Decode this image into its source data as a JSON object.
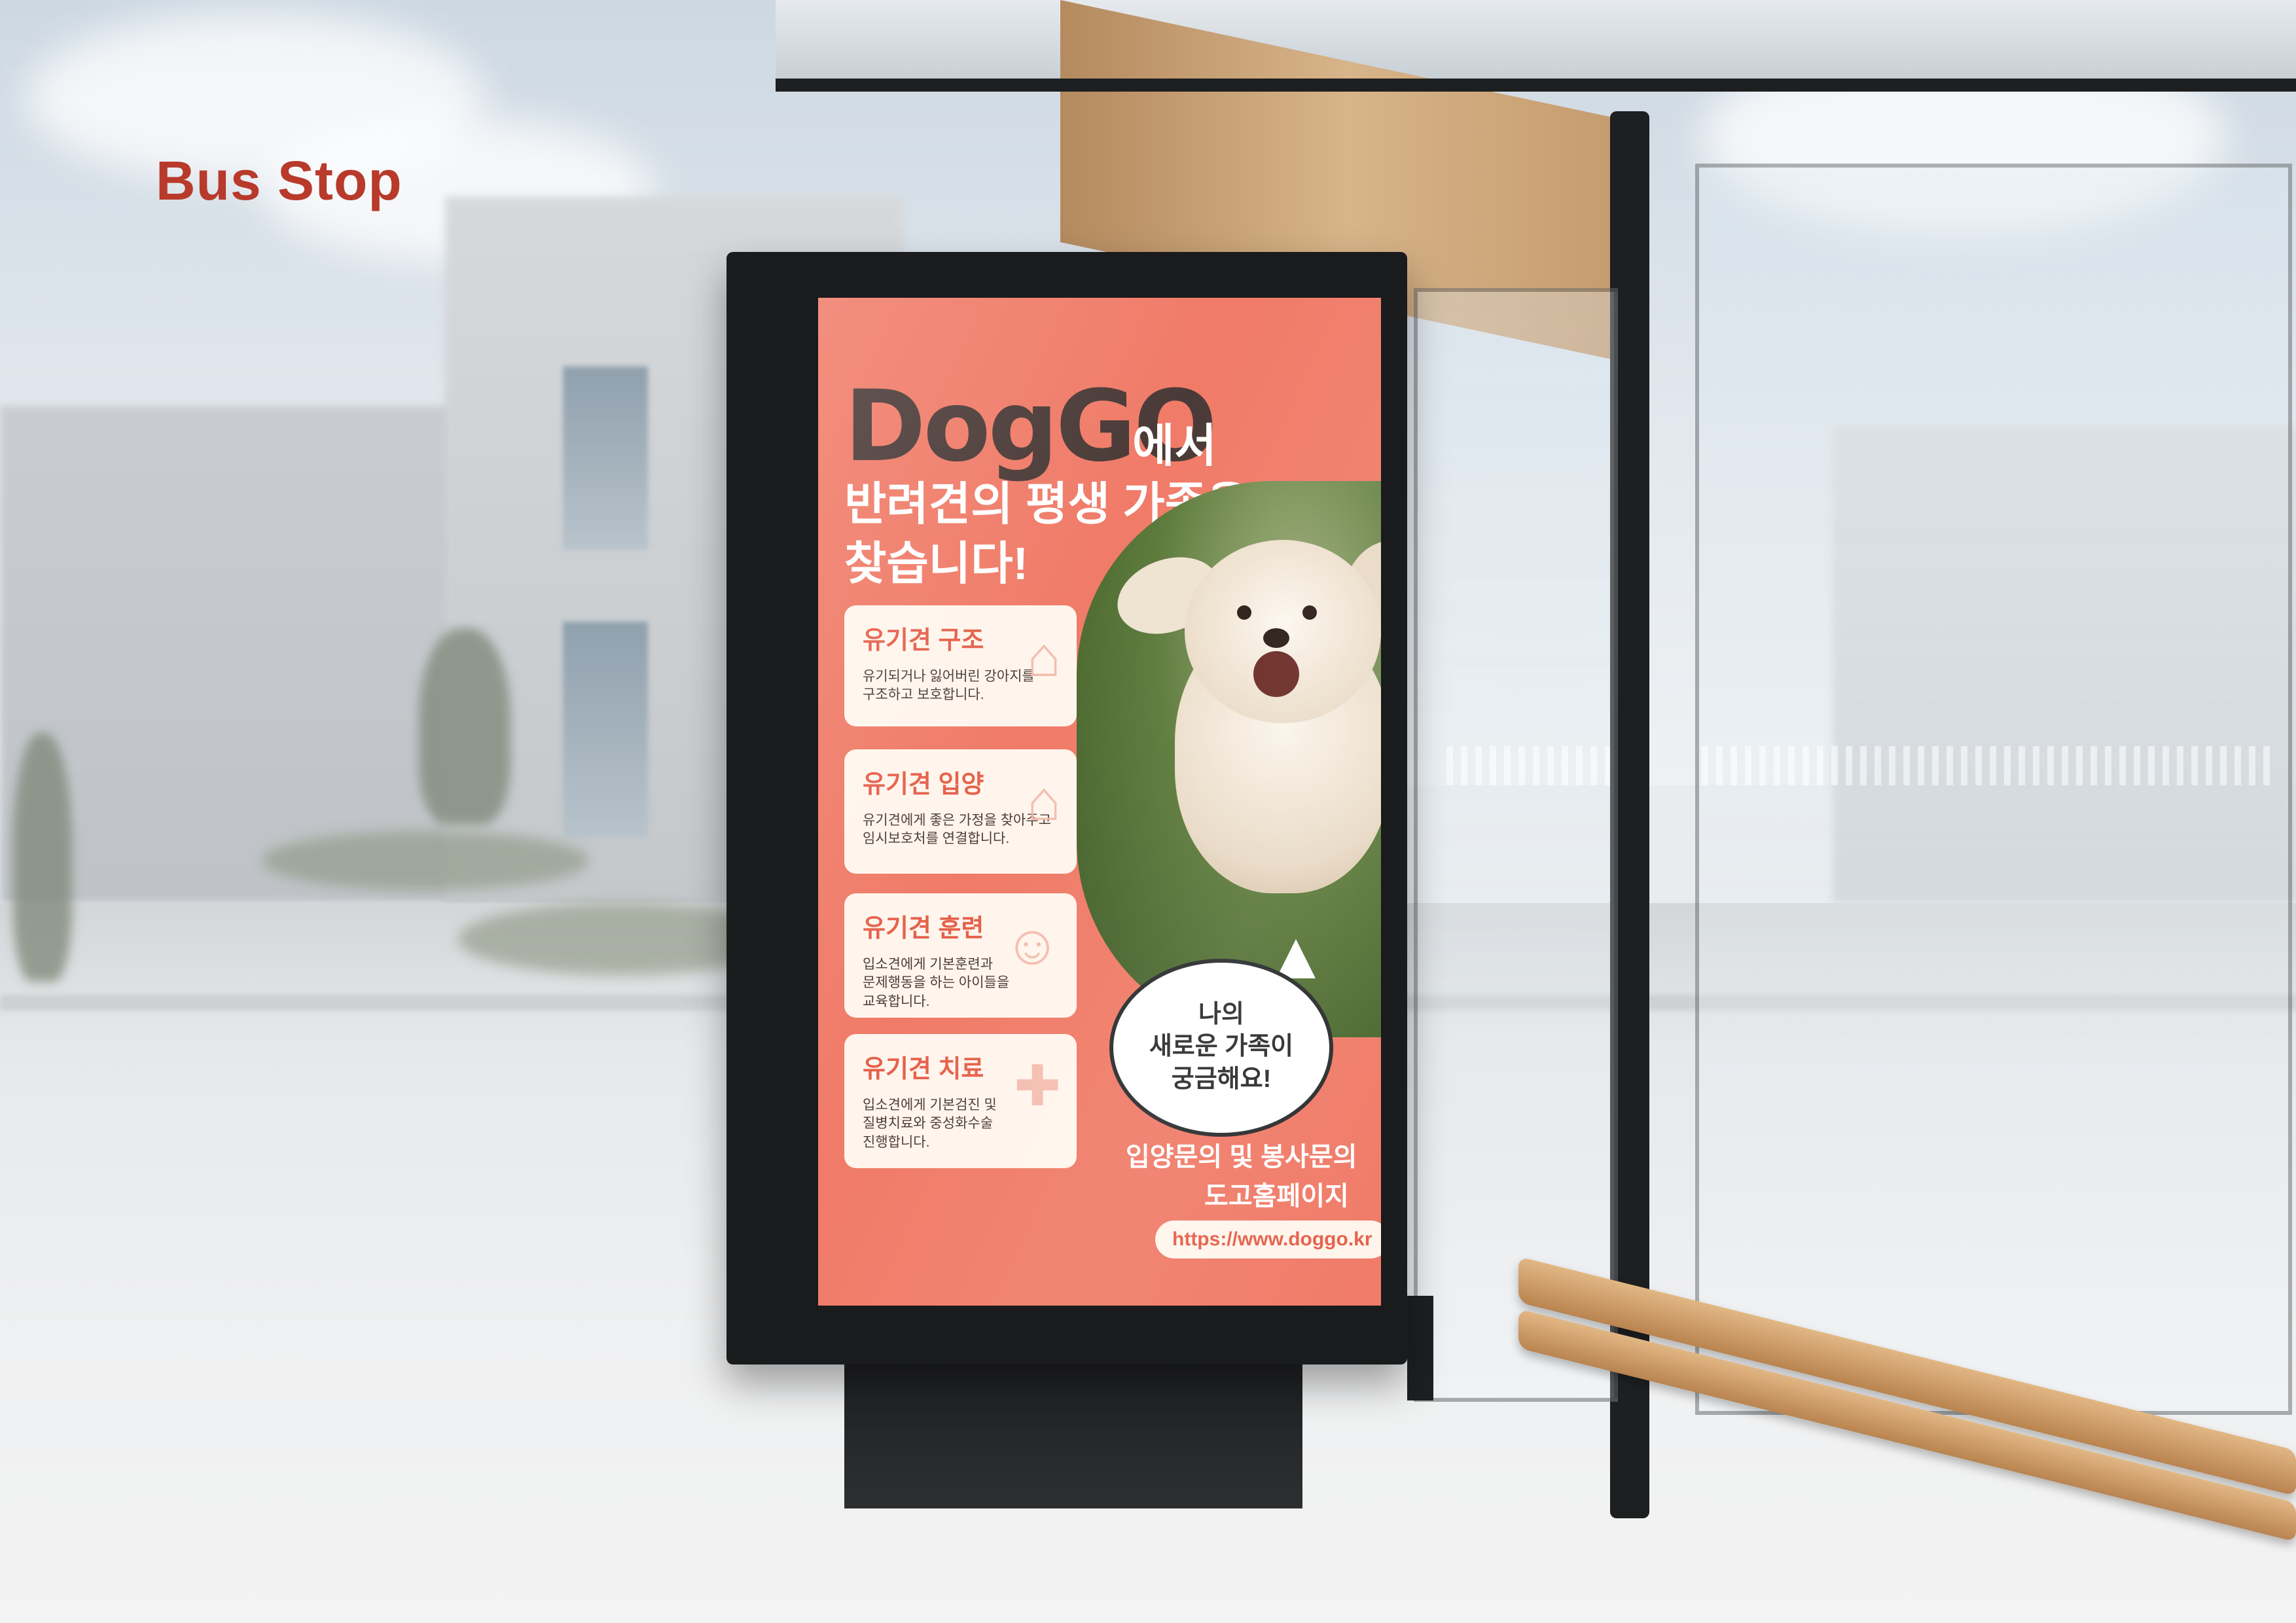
{
  "page": {
    "headline": "Bus Stop"
  },
  "colors": {
    "accent": "#b83a2b",
    "poster_bg": "#f07b68",
    "poster_dark": "#4a3a37",
    "card_bg": "#fff5ec"
  },
  "poster": {
    "logo": "DogGO",
    "logo_suffix": "에서",
    "title_line1": "반려견의 평생 가족을",
    "title_line2": "찾습니다!",
    "services": [
      {
        "title": "유기견 구조",
        "desc_1": "유기되거나 잃어버린 강아지를",
        "desc_2": "구조하고 보호합니다.",
        "desc_3": "",
        "icon": "dog-house-icon"
      },
      {
        "title": "유기견 입양",
        "desc_1": "유기견에게 좋은 가정을 찾아주고",
        "desc_2": "임시보호처를 연결합니다.",
        "desc_3": "",
        "icon": "home-icon"
      },
      {
        "title": "유기견 훈련",
        "desc_1": "입소견에게 기본훈련과",
        "desc_2": "문제행동을 하는 아이들을",
        "desc_3": "교육합니다.",
        "icon": "training-icon"
      },
      {
        "title": "유기견 치료",
        "desc_1": "입소견에게 기본검진 및",
        "desc_2": "질병치료와 중성화수술",
        "desc_3": "진행합니다.",
        "icon": "paw-medical-icon"
      }
    ],
    "bubble_line1": "나의",
    "bubble_line2": "새로운 가족이",
    "bubble_line3": "궁금해요!",
    "contact_line1": "입양문의 및 봉사문의",
    "contact_line2": "도고홈페이지",
    "url": "https://www.doggo.kr"
  }
}
